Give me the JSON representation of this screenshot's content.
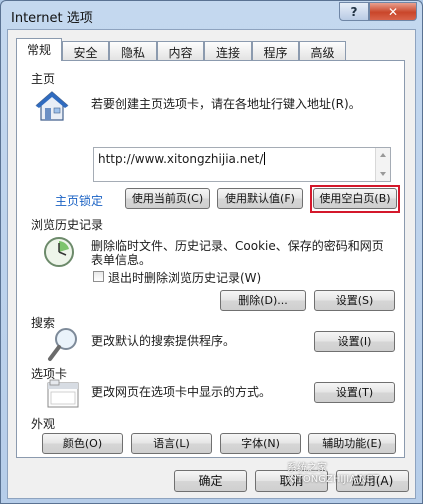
{
  "window": {
    "title": "Internet 选项",
    "help_label": "?",
    "close_label": "✕"
  },
  "tabs": [
    "常规",
    "安全",
    "隐私",
    "内容",
    "连接",
    "程序",
    "高级"
  ],
  "homepage": {
    "section": "主页",
    "hint": "若要创建主页选项卡，请在各地址行键入地址(R)。",
    "url": "http://www.xitongzhijia.net/",
    "locked": "主页锁定",
    "use_current": "使用当前页(C)",
    "use_default": "使用默认值(F)",
    "use_blank": "使用空白页(B)"
  },
  "history": {
    "section": "浏览历史记录",
    "desc_line1": "删除临时文件、历史记录、Cookie、保存的密码和网页",
    "desc_line2": "表单信息。",
    "checkbox": "退出时删除浏览历史记录(W)",
    "delete": "删除(D)...",
    "settings": "设置(S)"
  },
  "search": {
    "section": "搜索",
    "desc": "更改默认的搜索提供程序。",
    "settings": "设置(I)"
  },
  "tabsection": {
    "section": "选项卡",
    "desc": "更改网页在选项卡中显示的方式。",
    "settings": "设置(T)"
  },
  "appearance": {
    "section": "外观",
    "colors": "颜色(O)",
    "languages": "语言(L)",
    "fonts": "字体(N)",
    "accessibility": "辅助功能(E)"
  },
  "footer": {
    "ok": "确定",
    "cancel": "取消",
    "apply": "应用(A)"
  },
  "watermark": "系统之家 XITONGZHIJIA.NET"
}
